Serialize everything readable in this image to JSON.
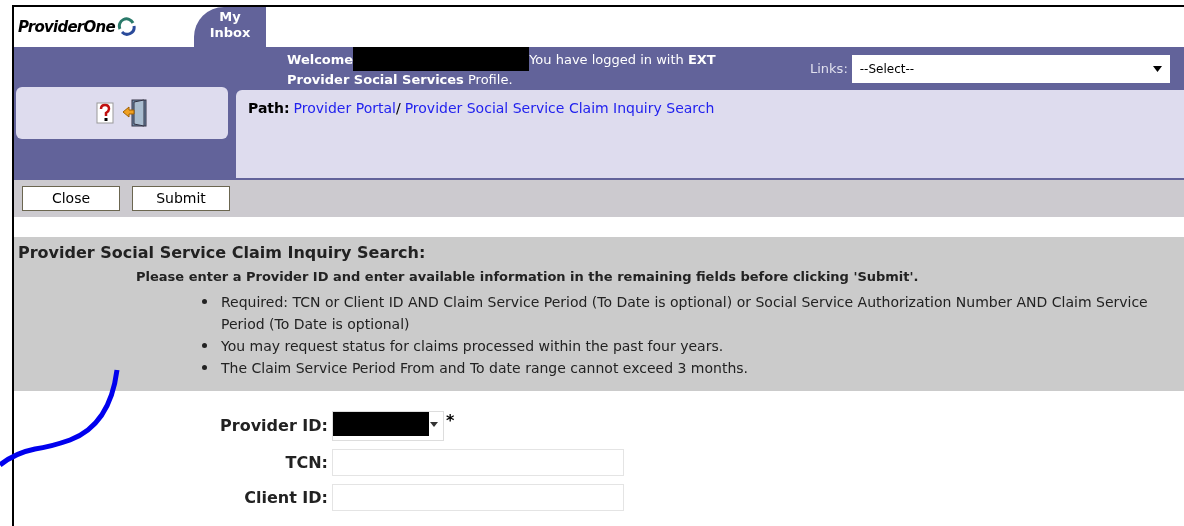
{
  "header": {
    "logo": "ProviderOne",
    "tabs": [
      {
        "label": "My Inbox",
        "selected": true
      }
    ]
  },
  "welcome": {
    "greeting": "Welcome",
    "message": "You have logged in with **EXT**",
    "message_line_2": "**Provider Social Services** Profile."
  },
  "links": {
    "label": "Links:",
    "value": "--Select--"
  },
  "path": {
    "label": "Path:",
    "items": [
      {
        "text": "Provider Portal",
        "separator": "/"
      },
      {
        "text": "Provider Social Service Claim Inquiry Search"
      }
    ]
  },
  "toolbar": {
    "buttons": [
      "Close",
      "Submit"
    ]
  },
  "info": {
    "title": "Provider Social Service Claim Inquiry Search:",
    "instruction": "Please enter a Provider ID and enter available information in the remaining fields before clicking 'Submit'.",
    "bullets": [
      "Required: TCN or Client ID AND Claim Service Period (To Date is optional) or Social Service Authorization Number AND Claim Service Period (To Date is optional)",
      "You may request status for claims processed within the past four years.",
      "The Claim Service Period From and To date range cannot exceed 3 months."
    ]
  },
  "form": {
    "fields": [
      {
        "label": "Provider ID:",
        "kind": "select",
        "required_mark": "*"
      },
      {
        "label": "TCN:",
        "kind": "text"
      },
      {
        "label": "Client ID:",
        "kind": "text"
      }
    ]
  }
}
